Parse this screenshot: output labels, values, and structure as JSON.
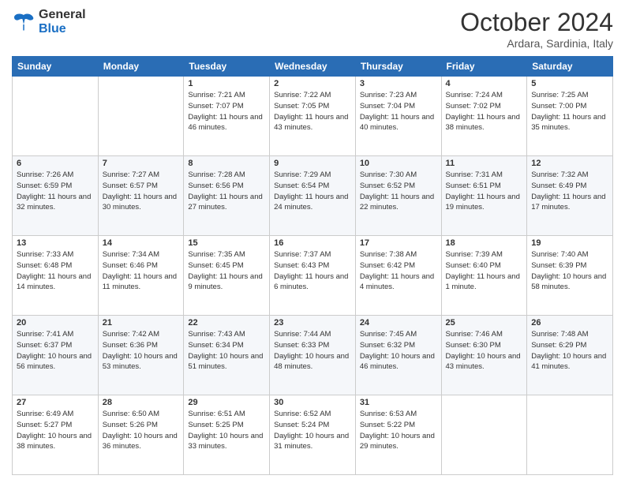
{
  "header": {
    "logo_general": "General",
    "logo_blue": "Blue",
    "month_title": "October 2024",
    "location": "Ardara, Sardinia, Italy"
  },
  "weekdays": [
    "Sunday",
    "Monday",
    "Tuesday",
    "Wednesday",
    "Thursday",
    "Friday",
    "Saturday"
  ],
  "weeks": [
    [
      {
        "day": "",
        "sunrise": "",
        "sunset": "",
        "daylight": ""
      },
      {
        "day": "",
        "sunrise": "",
        "sunset": "",
        "daylight": ""
      },
      {
        "day": "1",
        "sunrise": "Sunrise: 7:21 AM",
        "sunset": "Sunset: 7:07 PM",
        "daylight": "Daylight: 11 hours and 46 minutes."
      },
      {
        "day": "2",
        "sunrise": "Sunrise: 7:22 AM",
        "sunset": "Sunset: 7:05 PM",
        "daylight": "Daylight: 11 hours and 43 minutes."
      },
      {
        "day": "3",
        "sunrise": "Sunrise: 7:23 AM",
        "sunset": "Sunset: 7:04 PM",
        "daylight": "Daylight: 11 hours and 40 minutes."
      },
      {
        "day": "4",
        "sunrise": "Sunrise: 7:24 AM",
        "sunset": "Sunset: 7:02 PM",
        "daylight": "Daylight: 11 hours and 38 minutes."
      },
      {
        "day": "5",
        "sunrise": "Sunrise: 7:25 AM",
        "sunset": "Sunset: 7:00 PM",
        "daylight": "Daylight: 11 hours and 35 minutes."
      }
    ],
    [
      {
        "day": "6",
        "sunrise": "Sunrise: 7:26 AM",
        "sunset": "Sunset: 6:59 PM",
        "daylight": "Daylight: 11 hours and 32 minutes."
      },
      {
        "day": "7",
        "sunrise": "Sunrise: 7:27 AM",
        "sunset": "Sunset: 6:57 PM",
        "daylight": "Daylight: 11 hours and 30 minutes."
      },
      {
        "day": "8",
        "sunrise": "Sunrise: 7:28 AM",
        "sunset": "Sunset: 6:56 PM",
        "daylight": "Daylight: 11 hours and 27 minutes."
      },
      {
        "day": "9",
        "sunrise": "Sunrise: 7:29 AM",
        "sunset": "Sunset: 6:54 PM",
        "daylight": "Daylight: 11 hours and 24 minutes."
      },
      {
        "day": "10",
        "sunrise": "Sunrise: 7:30 AM",
        "sunset": "Sunset: 6:52 PM",
        "daylight": "Daylight: 11 hours and 22 minutes."
      },
      {
        "day": "11",
        "sunrise": "Sunrise: 7:31 AM",
        "sunset": "Sunset: 6:51 PM",
        "daylight": "Daylight: 11 hours and 19 minutes."
      },
      {
        "day": "12",
        "sunrise": "Sunrise: 7:32 AM",
        "sunset": "Sunset: 6:49 PM",
        "daylight": "Daylight: 11 hours and 17 minutes."
      }
    ],
    [
      {
        "day": "13",
        "sunrise": "Sunrise: 7:33 AM",
        "sunset": "Sunset: 6:48 PM",
        "daylight": "Daylight: 11 hours and 14 minutes."
      },
      {
        "day": "14",
        "sunrise": "Sunrise: 7:34 AM",
        "sunset": "Sunset: 6:46 PM",
        "daylight": "Daylight: 11 hours and 11 minutes."
      },
      {
        "day": "15",
        "sunrise": "Sunrise: 7:35 AM",
        "sunset": "Sunset: 6:45 PM",
        "daylight": "Daylight: 11 hours and 9 minutes."
      },
      {
        "day": "16",
        "sunrise": "Sunrise: 7:37 AM",
        "sunset": "Sunset: 6:43 PM",
        "daylight": "Daylight: 11 hours and 6 minutes."
      },
      {
        "day": "17",
        "sunrise": "Sunrise: 7:38 AM",
        "sunset": "Sunset: 6:42 PM",
        "daylight": "Daylight: 11 hours and 4 minutes."
      },
      {
        "day": "18",
        "sunrise": "Sunrise: 7:39 AM",
        "sunset": "Sunset: 6:40 PM",
        "daylight": "Daylight: 11 hours and 1 minute."
      },
      {
        "day": "19",
        "sunrise": "Sunrise: 7:40 AM",
        "sunset": "Sunset: 6:39 PM",
        "daylight": "Daylight: 10 hours and 58 minutes."
      }
    ],
    [
      {
        "day": "20",
        "sunrise": "Sunrise: 7:41 AM",
        "sunset": "Sunset: 6:37 PM",
        "daylight": "Daylight: 10 hours and 56 minutes."
      },
      {
        "day": "21",
        "sunrise": "Sunrise: 7:42 AM",
        "sunset": "Sunset: 6:36 PM",
        "daylight": "Daylight: 10 hours and 53 minutes."
      },
      {
        "day": "22",
        "sunrise": "Sunrise: 7:43 AM",
        "sunset": "Sunset: 6:34 PM",
        "daylight": "Daylight: 10 hours and 51 minutes."
      },
      {
        "day": "23",
        "sunrise": "Sunrise: 7:44 AM",
        "sunset": "Sunset: 6:33 PM",
        "daylight": "Daylight: 10 hours and 48 minutes."
      },
      {
        "day": "24",
        "sunrise": "Sunrise: 7:45 AM",
        "sunset": "Sunset: 6:32 PM",
        "daylight": "Daylight: 10 hours and 46 minutes."
      },
      {
        "day": "25",
        "sunrise": "Sunrise: 7:46 AM",
        "sunset": "Sunset: 6:30 PM",
        "daylight": "Daylight: 10 hours and 43 minutes."
      },
      {
        "day": "26",
        "sunrise": "Sunrise: 7:48 AM",
        "sunset": "Sunset: 6:29 PM",
        "daylight": "Daylight: 10 hours and 41 minutes."
      }
    ],
    [
      {
        "day": "27",
        "sunrise": "Sunrise: 6:49 AM",
        "sunset": "Sunset: 5:27 PM",
        "daylight": "Daylight: 10 hours and 38 minutes."
      },
      {
        "day": "28",
        "sunrise": "Sunrise: 6:50 AM",
        "sunset": "Sunset: 5:26 PM",
        "daylight": "Daylight: 10 hours and 36 minutes."
      },
      {
        "day": "29",
        "sunrise": "Sunrise: 6:51 AM",
        "sunset": "Sunset: 5:25 PM",
        "daylight": "Daylight: 10 hours and 33 minutes."
      },
      {
        "day": "30",
        "sunrise": "Sunrise: 6:52 AM",
        "sunset": "Sunset: 5:24 PM",
        "daylight": "Daylight: 10 hours and 31 minutes."
      },
      {
        "day": "31",
        "sunrise": "Sunrise: 6:53 AM",
        "sunset": "Sunset: 5:22 PM",
        "daylight": "Daylight: 10 hours and 29 minutes."
      },
      {
        "day": "",
        "sunrise": "",
        "sunset": "",
        "daylight": ""
      },
      {
        "day": "",
        "sunrise": "",
        "sunset": "",
        "daylight": ""
      }
    ]
  ]
}
